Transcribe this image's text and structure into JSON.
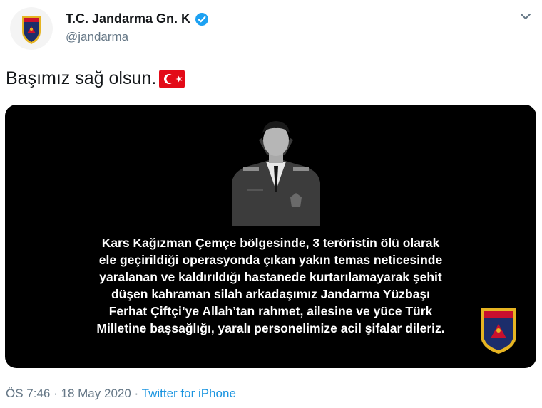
{
  "tweet": {
    "display_name": "T.C. Jandarma Gn. K",
    "handle": "@jandarma",
    "text": "Başımız sağ olsun.",
    "media_text": "Kars Kağızman Çemçe bölgesinde, 3 teröristin ölü olarak\nele geçirildiği operasyonda çıkan yakın temas neticesinde\nyaralanan ve kaldırıldığı hastanede kurtarılamayarak şehit\ndüşen kahraman silah arkadaşımız Jandarma Yüzbaşı\nFerhat Çiftçi’ye Allah’tan rahmet, ailesine ve yüce Türk\nMilletine başsağlığı, yaralı personelimize acil şifalar dileriz.",
    "time": "ÖS 7:46",
    "separator": "·",
    "date": "18 May 2020",
    "source": "Twitter for iPhone"
  },
  "icons": {
    "avatar": "jandarma-emblem",
    "verified": "verified-badge-icon",
    "more": "chevron-down-icon",
    "flag": "turkish-flag-emoji"
  },
  "colors": {
    "link": "#1b95e0",
    "secondary_text": "#657786",
    "verified": "#1da1f2",
    "flag_red": "#e30a17",
    "emblem_red": "#c8102e",
    "emblem_navy": "#1c2d6b",
    "emblem_gold": "#e6b422",
    "media_bg": "#000000"
  }
}
